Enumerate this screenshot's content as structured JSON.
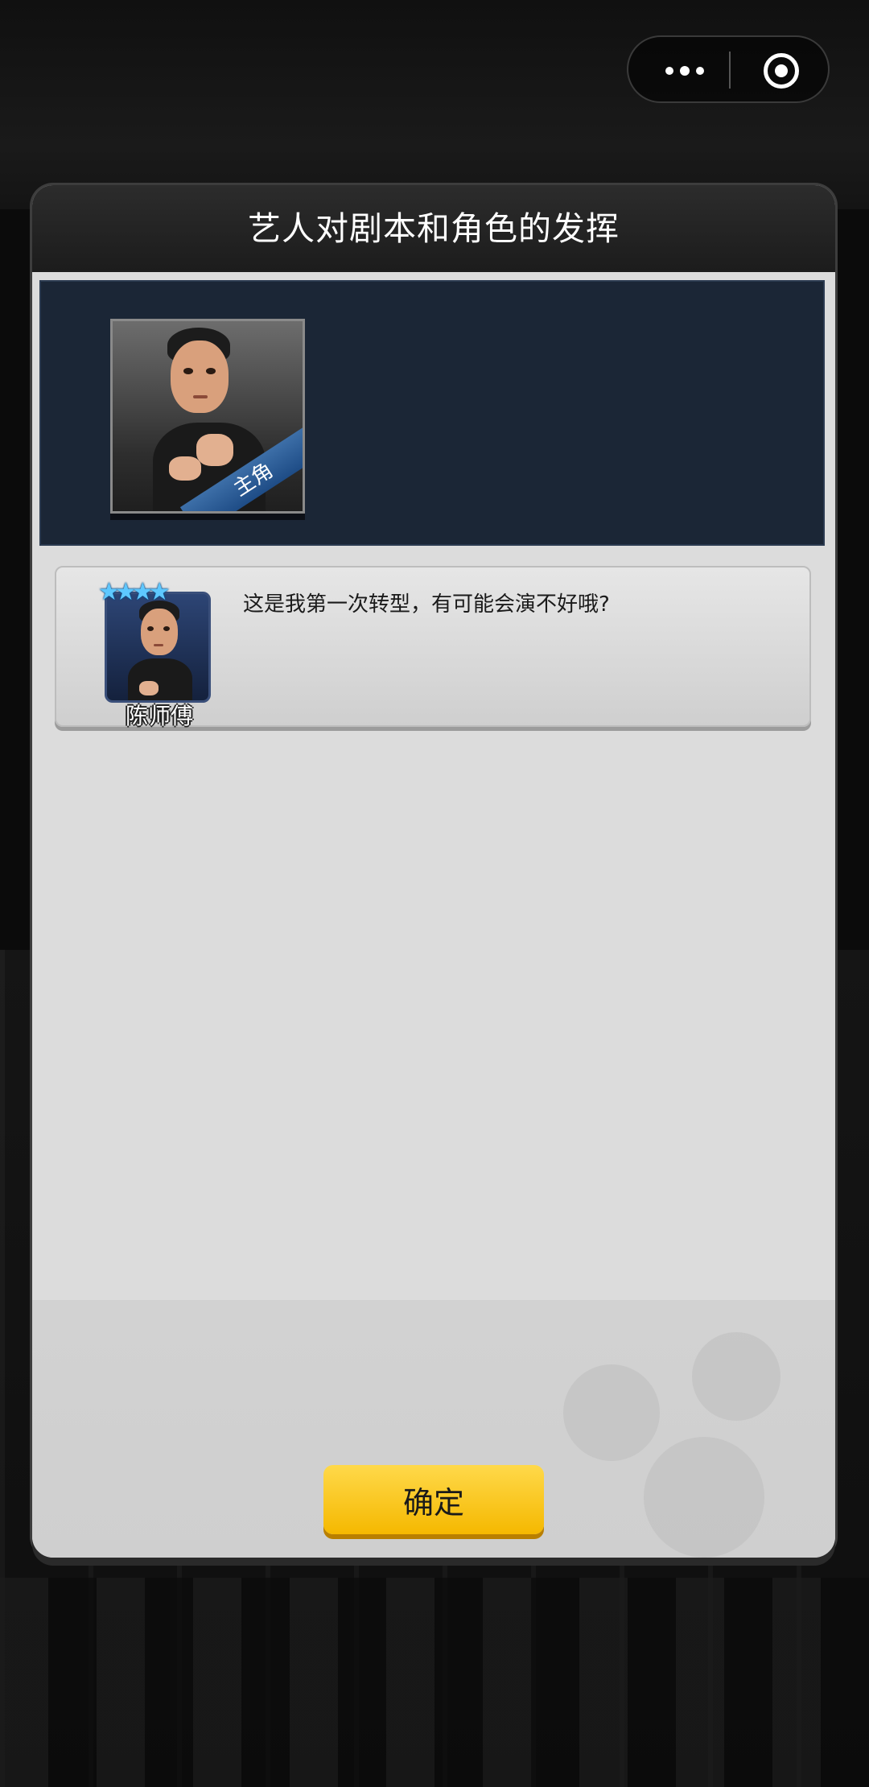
{
  "capsule": {
    "more_icon": "more-dots-icon",
    "close_icon": "target-close-icon"
  },
  "dialog": {
    "title": "艺人对剧本和角色的发挥",
    "hero": {
      "role_badge": "主角"
    },
    "dialogue": {
      "stars": [
        "★",
        "★",
        "★",
        "★"
      ],
      "actor_name": "陈师傅",
      "line": "这是我第一次转型，有可能会演不好哦?"
    },
    "confirm_label": "确定"
  },
  "colors": {
    "confirm": "#f5b800",
    "title_bar": "#1c1c1c",
    "hero_panel": "#1b2636",
    "star": "#5ec8ff"
  }
}
